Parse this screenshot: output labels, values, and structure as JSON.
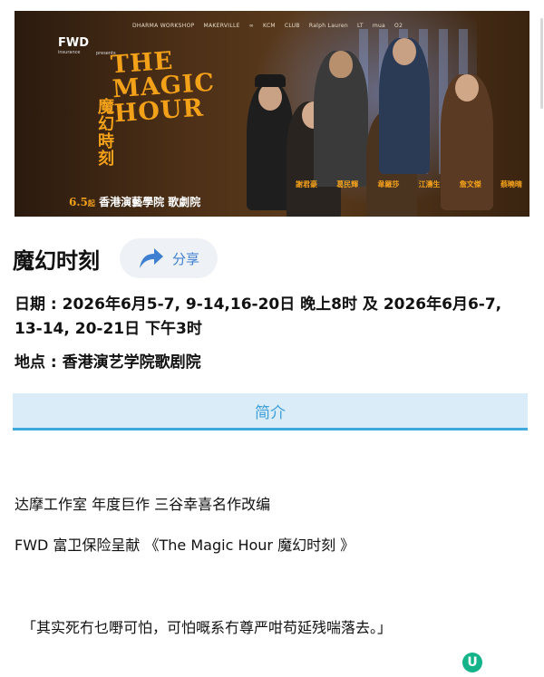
{
  "banner": {
    "sponsors": [
      "DHARMA WORKSHOP",
      "MAKERVILLE",
      "∞",
      "KCM",
      "CLUB",
      "Ralph Lauren",
      "LT",
      "mua",
      "O2"
    ],
    "insurer_logo": "FWD",
    "insurer_sub": "insurance",
    "presents": "presents",
    "show_title_en": "THE MAGIC HOUR",
    "show_title_zh": "魔幻時刻",
    "date_prefix": "6.5",
    "date_suffix": "起",
    "venue_text": "香港演藝學院 歌劇院",
    "cast": [
      "謝君豪",
      "葛民輝",
      "韋羅莎",
      "江濤生",
      "詹文傑",
      "蔡曉晴"
    ]
  },
  "header": {
    "title": "魔幻时刻",
    "share_label": "分享"
  },
  "details": {
    "date_line": "日期 : 2026年6月5-7, 9-14,16-20日 晚上8时 及 2026年6月6-7, 13-14, 20-21日 下午3时",
    "venue_line": "地点 : 香港演艺学院歌剧院"
  },
  "tabs": {
    "intro_label": "简介"
  },
  "content": {
    "p1": "达摩工作室 年度巨作 三谷幸喜名作改编",
    "p2": "FWD 富卫保险呈献 《The Magic Hour 魔幻时刻 》",
    "quote": "「其实死冇乜嘢可怕，可怕嘅系冇尊严咁苟延残喘落去。」"
  },
  "floating_icon": {
    "glyph": "U",
    "color": "#14b38a"
  },
  "colors": {
    "accent": "#3f9fd8",
    "tab_bg": "#d9ecf7",
    "title_gold": "#f4a11a"
  }
}
